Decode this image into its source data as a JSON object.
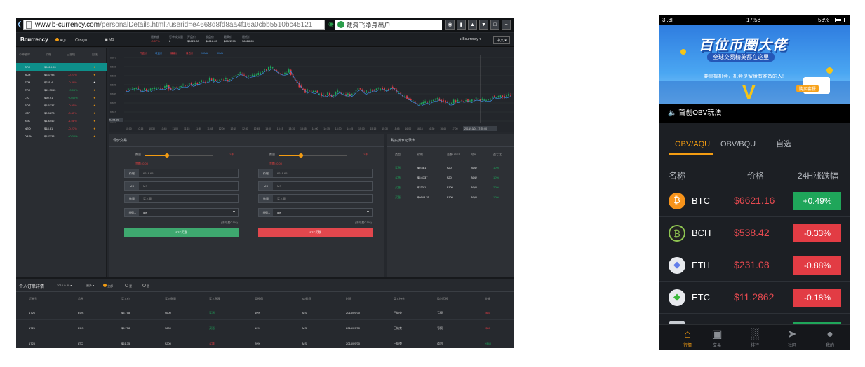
{
  "desktop": {
    "browser": {
      "url_main": "www.b-currency.com",
      "url_rest": "/personalDetails.html?userid=e4668d8fd8aa4f16a0cbb5510bc45121",
      "search_text": "戴鸿飞净身出户"
    },
    "header": {
      "logo": "Bcurrency",
      "radio1": "AQU",
      "radio2": "BQU",
      "interval": "MS",
      "tickers": [
        {
          "label": "最新额",
          "value": "-0.07%"
        },
        {
          "label": "订单成交量",
          "value": "8"
        },
        {
          "label": "开盘价",
          "value": "$6623.30"
        },
        {
          "label": "收盘价",
          "value": "$6618.65"
        },
        {
          "label": "最高价",
          "value": "$6622.95"
        },
        {
          "label": "最低价",
          "value": "$6618.65"
        }
      ],
      "user": "Bcurrency",
      "lang": "中文"
    },
    "market_list": {
      "headers": [
        "币种名称",
        "价格",
        "日涨幅",
        "自选"
      ],
      "rows": [
        {
          "name": "BTC",
          "price": "$6618.65",
          "change": "",
          "fav": "★"
        },
        {
          "name": "BCH",
          "price": "$537.93",
          "change": "-0.21%",
          "fav": "★"
        },
        {
          "name": "ETH",
          "price": "$231.4",
          "change": "-0.48%",
          "fav": "★"
        },
        {
          "name": "ETC",
          "price": "$11.3063",
          "change": "+0.06%",
          "fav": "★"
        },
        {
          "name": "LTC",
          "price": "$60.91",
          "change": "+0.40%",
          "fav": "★"
        },
        {
          "name": "EOS",
          "price": "$5.6737",
          "change": "-0.95%",
          "fav": "★"
        },
        {
          "name": "XRP",
          "price": "$0.5873",
          "change": "-0.45%",
          "fav": "★"
        },
        {
          "name": "ZEC",
          "price": "$130.42",
          "change": "-1.08%",
          "fav": "★"
        },
        {
          "name": "NEO",
          "price": "$18.81",
          "change": "-0.27%",
          "fav": "★"
        },
        {
          "name": "DASH",
          "price": "$187.33",
          "change": "+0.00%",
          "fav": "★"
        }
      ]
    },
    "chart": {
      "legend": [
        "开盘价",
        "收盘价",
        "最高价",
        "最低价",
        "15MA",
        "30MA"
      ],
      "y_ticks": [
        "6,670",
        "6,660",
        "6,650",
        "6,640",
        "6,630",
        "6,620",
        "6,610",
        "6,600"
      ],
      "y_marker": "6,601.23",
      "x_ticks": [
        "10:00",
        "10:15",
        "10:30",
        "10:45",
        "11:00",
        "11:15",
        "11:30",
        "11:45",
        "12:00",
        "12:15",
        "12:30",
        "12:45",
        "13:00",
        "13:15",
        "13:30",
        "13:45",
        "14:00",
        "14:15",
        "14:30",
        "14:45",
        "15:00",
        "15:15",
        "15:30",
        "15:45",
        "16:00",
        "16:15",
        "16:30",
        "16:45",
        "17:00",
        "17:15",
        "17:30",
        "17:45"
      ],
      "x_marker": "2018/10/01 17:25:00",
      "x_end": "17:45"
    },
    "trade": {
      "title": "现价交易",
      "buy": {
        "price_label": "价格",
        "price_value": "6618.65",
        "ms_label": "MS",
        "ms_value": "MS",
        "qty_label": "数量",
        "qty_placeholder": "买入量",
        "rate_label": "止损比",
        "rate_value": "5%",
        "slider_label": "数量",
        "slider_end": "1手",
        "balance": "余额: 0.00",
        "fee": "(手续费0.5%)",
        "button": "BTC买涨"
      },
      "sell": {
        "price_label": "价格",
        "price_value": "6618.65",
        "ms_label": "MS",
        "ms_value": "MS",
        "qty_label": "数量",
        "qty_placeholder": "买入量",
        "rate_label": "止损比",
        "rate_value": "5%",
        "slider_label": "数量",
        "slider_end": "1手",
        "balance": "余额: 0.00",
        "fee": "(手续费0.5%)",
        "button": "BTC买跌"
      }
    },
    "stream": {
      "title": "购买流水记录表",
      "headers": [
        "类型",
        "价格",
        "金额USDT",
        "时间",
        "盈亏比"
      ],
      "rows": [
        {
          "type": "买涨",
          "price": "$0.5817",
          "amount": "$20",
          "time": "BQU",
          "ratio": "10%"
        },
        {
          "type": "买涨",
          "price": "$5.6737",
          "amount": "$20",
          "time": "BQU",
          "ratio": "10%"
        },
        {
          "type": "买涨",
          "price": "$230.1",
          "amount": "$100",
          "time": "BQU",
          "ratio": "20%"
        },
        {
          "type": "买涨",
          "price": "$6643.35",
          "amount": "$100",
          "time": "BQU",
          "ratio": "10%"
        }
      ]
    },
    "orders": {
      "title": "个人订单详情",
      "date_filter": "2018-9-30",
      "type_filter": "更多",
      "radio_all": "全部",
      "radio_yes": "是",
      "radio_no": "否",
      "headers": [
        "订单号",
        "品种",
        "买入价",
        "买入数量",
        "买入涨跌",
        "盈损值",
        "M/时间",
        "时间",
        "买入持仓",
        "盈利亏损",
        "金额"
      ],
      "rows": [
        {
          "id": "1726",
          "coin": "EOS",
          "price": "$5.758",
          "qty": "$600",
          "dir": "买涨",
          "ratio": "10%",
          "m": "MS",
          "date": "2018/09/30",
          "status": "已结束",
          "result": "亏损",
          "amount": "-$60"
        },
        {
          "id": "1725",
          "coin": "EOS",
          "price": "$5.758",
          "qty": "$600",
          "dir": "买涨",
          "ratio": "10%",
          "m": "MS",
          "date": "2018/09/30",
          "status": "已结束",
          "result": "亏损",
          "amount": "-$60"
        },
        {
          "id": "1723",
          "coin": "LTC",
          "price": "$61.35",
          "qty": "$200",
          "dir": "买跌",
          "ratio": "20%",
          "m": "MS",
          "date": "2018/09/30",
          "status": "已结束",
          "result": "盈利",
          "amount": "+$40"
        }
      ]
    }
  },
  "phone": {
    "status": {
      "signal": "3l.3l",
      "time": "17:58",
      "battery": "53%"
    },
    "banner": {
      "title": "百位币圈大佬",
      "subtitle": "全球交易精英都在这里",
      "line": "要掌握机会，机会是留给有准备的人!",
      "cta": "购买套餐"
    },
    "notice": "首创OBV玩法",
    "tabs": [
      "OBV/AQU",
      "OBV/BQU",
      "自选"
    ],
    "headers": [
      "名称",
      "价格",
      "24H涨跌幅"
    ],
    "coins": [
      {
        "name": "BTC",
        "price": "$6621.16",
        "change": "+0.49%",
        "icon": "bitcoin-icon",
        "color": "#f7931a",
        "up": true
      },
      {
        "name": "BCH",
        "price": "$538.42",
        "change": "-0.33%",
        "icon": "bitcoin-cash-icon",
        "color": "#8dc351",
        "up": false
      },
      {
        "name": "ETH",
        "price": "$231.08",
        "change": "-0.88%",
        "icon": "ethereum-icon",
        "color": "#627eea",
        "up": false
      },
      {
        "name": "ETC",
        "price": "$11.2862",
        "change": "-0.18%",
        "icon": "ethereum-classic-icon",
        "color": "#3ab83a",
        "up": false
      }
    ],
    "tabbar": [
      "行情",
      "交易",
      "排行",
      "社区",
      "我的"
    ]
  },
  "colors": {
    "up": "#1fa65a",
    "down": "#e23c44",
    "accent": "#f39c12",
    "select": "#0e8f8a"
  }
}
